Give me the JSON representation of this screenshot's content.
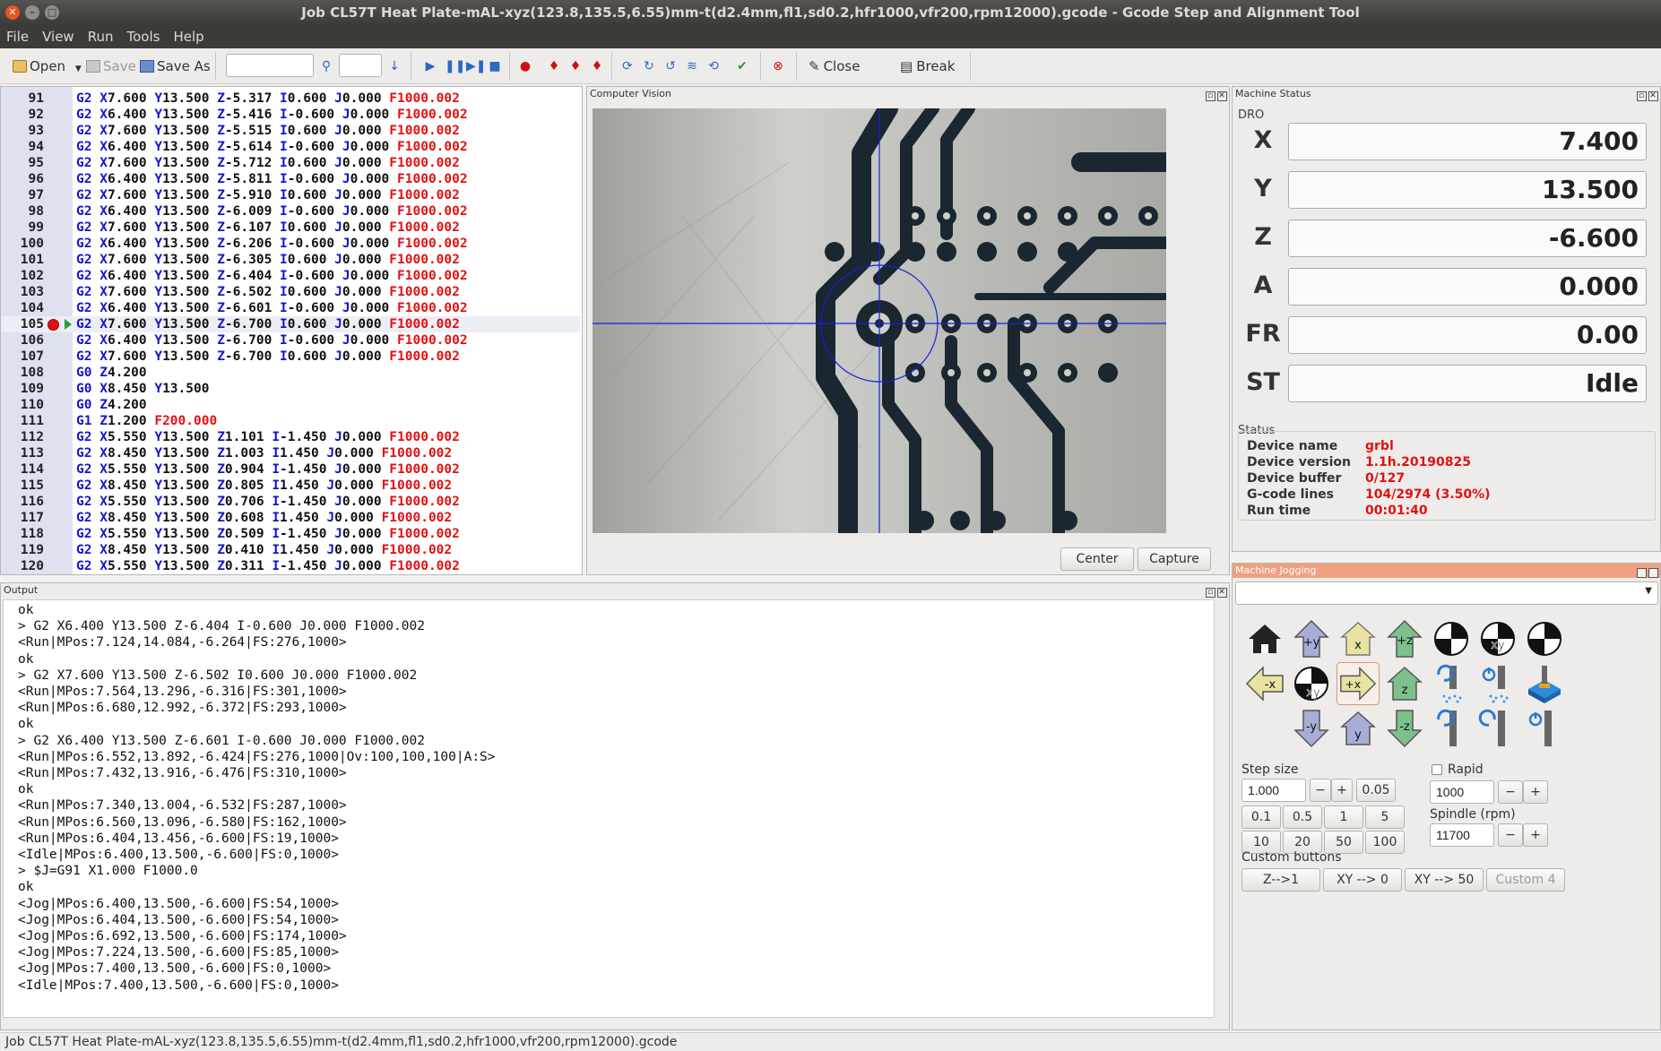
{
  "window": {
    "title": "Job CL57T Heat Plate-mAL-xyz(123.8,135.5,6.55)mm-t(d2.4mm,fl1,sd0.2,hfr1000,vfr200,rpm12000).gcode - Gcode Step and Alignment Tool"
  },
  "menu": [
    "File",
    "View",
    "Run",
    "Tools",
    "Help"
  ],
  "toolbar": {
    "open": "Open",
    "save": "Save",
    "save_as": "Save As",
    "close": "Close",
    "break": "Break",
    "search_value": "",
    "line_value": ""
  },
  "editor": {
    "lines": [
      {
        "n": "91",
        "t": "G2 X7.600 Y13.500 Z-5.317 I0.600 J0.000 F1000.002"
      },
      {
        "n": "92",
        "t": "G2 X6.400 Y13.500 Z-5.416 I-0.600 J0.000 F1000.002"
      },
      {
        "n": "93",
        "t": "G2 X7.600 Y13.500 Z-5.515 I0.600 J0.000 F1000.002"
      },
      {
        "n": "94",
        "t": "G2 X6.400 Y13.500 Z-5.614 I-0.600 J0.000 F1000.002"
      },
      {
        "n": "95",
        "t": "G2 X7.600 Y13.500 Z-5.712 I0.600 J0.000 F1000.002"
      },
      {
        "n": "96",
        "t": "G2 X6.400 Y13.500 Z-5.811 I-0.600 J0.000 F1000.002"
      },
      {
        "n": "97",
        "t": "G2 X7.600 Y13.500 Z-5.910 I0.600 J0.000 F1000.002"
      },
      {
        "n": "98",
        "t": "G2 X6.400 Y13.500 Z-6.009 I-0.600 J0.000 F1000.002"
      },
      {
        "n": "99",
        "t": "G2 X7.600 Y13.500 Z-6.107 I0.600 J0.000 F1000.002"
      },
      {
        "n": "100",
        "t": "G2 X6.400 Y13.500 Z-6.206 I-0.600 J0.000 F1000.002"
      },
      {
        "n": "101",
        "t": "G2 X7.600 Y13.500 Z-6.305 I0.600 J0.000 F1000.002"
      },
      {
        "n": "102",
        "t": "G2 X6.400 Y13.500 Z-6.404 I-0.600 J0.000 F1000.002"
      },
      {
        "n": "103",
        "t": "G2 X7.600 Y13.500 Z-6.502 I0.600 J0.000 F1000.002"
      },
      {
        "n": "104",
        "t": "G2 X6.400 Y13.500 Z-6.601 I-0.600 J0.000 F1000.002"
      },
      {
        "n": "105",
        "t": "G2 X7.600 Y13.500 Z-6.700 I0.600 J0.000 F1000.002"
      },
      {
        "n": "106",
        "t": "G2 X6.400 Y13.500 Z-6.700 I-0.600 J0.000 F1000.002"
      },
      {
        "n": "107",
        "t": "G2 X7.600 Y13.500 Z-6.700 I0.600 J0.000 F1000.002"
      },
      {
        "n": "108",
        "t": "G0 Z4.200"
      },
      {
        "n": "109",
        "t": "G0 X8.450 Y13.500"
      },
      {
        "n": "110",
        "t": "G0 Z4.200"
      },
      {
        "n": "111",
        "t": "G1 Z1.200 F200.000"
      },
      {
        "n": "112",
        "t": "G2 X5.550 Y13.500 Z1.101 I-1.450 J0.000 F1000.002"
      },
      {
        "n": "113",
        "t": "G2 X8.450 Y13.500 Z1.003 I1.450 J0.000 F1000.002"
      },
      {
        "n": "114",
        "t": "G2 X5.550 Y13.500 Z0.904 I-1.450 J0.000 F1000.002"
      },
      {
        "n": "115",
        "t": "G2 X8.450 Y13.500 Z0.805 I1.450 J0.000 F1000.002"
      },
      {
        "n": "116",
        "t": "G2 X5.550 Y13.500 Z0.706 I-1.450 J0.000 F1000.002"
      },
      {
        "n": "117",
        "t": "G2 X8.450 Y13.500 Z0.608 I1.450 J0.000 F1000.002"
      },
      {
        "n": "118",
        "t": "G2 X5.550 Y13.500 Z0.509 I-1.450 J0.000 F1000.002"
      },
      {
        "n": "119",
        "t": "G2 X8.450 Y13.500 Z0.410 I1.450 J0.000 F1000.002"
      },
      {
        "n": "120",
        "t": "G2 X5.550 Y13.500 Z0.311 I-1.450 J0.000 F1000.002"
      }
    ],
    "current_line": "105"
  },
  "computer_vision": {
    "title": "Computer Vision",
    "center": "Center",
    "capture": "Capture"
  },
  "machine_status": {
    "title": "Machine Status",
    "dro_title": "DRO",
    "dro": [
      {
        "label": "X",
        "value": "7.400"
      },
      {
        "label": "Y",
        "value": "13.500"
      },
      {
        "label": "Z",
        "value": "-6.600"
      },
      {
        "label": "A",
        "value": "0.000"
      },
      {
        "label": "FR",
        "value": "0.00"
      },
      {
        "label": "ST",
        "value": "Idle"
      }
    ],
    "status_title": "Status",
    "status": [
      {
        "k": "Device name",
        "v": "grbl"
      },
      {
        "k": "Device version",
        "v": "1.1h.20190825"
      },
      {
        "k": "Device buffer",
        "v": "0/127"
      },
      {
        "k": "G-code lines",
        "v": "104/2974 (3.50%)"
      },
      {
        "k": "Run time",
        "v": "00:01:40"
      }
    ]
  },
  "output": {
    "title": "Output",
    "lines": [
      "ok",
      "> G2 X6.400 Y13.500 Z-6.404 I-0.600 J0.000 F1000.002",
      "<Run|MPos:7.124,14.084,-6.264|FS:276,1000>",
      "ok",
      "> G2 X7.600 Y13.500 Z-6.502 I0.600 J0.000 F1000.002",
      "<Run|MPos:7.564,13.296,-6.316|FS:301,1000>",
      "<Run|MPos:6.680,12.992,-6.372|FS:293,1000>",
      "ok",
      "> G2 X6.400 Y13.500 Z-6.601 I-0.600 J0.000 F1000.002",
      "<Run|MPos:6.552,13.892,-6.424|FS:276,1000|Ov:100,100,100|A:S>",
      "<Run|MPos:7.432,13.916,-6.476|FS:310,1000>",
      "ok",
      "<Run|MPos:7.340,13.004,-6.532|FS:287,1000>",
      "<Run|MPos:6.560,13.096,-6.580|FS:162,1000>",
      "<Run|MPos:6.404,13.456,-6.600|FS:19,1000>",
      "<Idle|MPos:6.400,13.500,-6.600|FS:0,1000>",
      "> $J=G91 X1.000 F1000.0",
      "ok",
      "<Jog|MPos:6.400,13.500,-6.600|FS:54,1000>",
      "<Jog|MPos:6.404,13.500,-6.600|FS:54,1000>",
      "<Jog|MPos:6.692,13.500,-6.600|FS:174,1000>",
      "<Jog|MPos:7.224,13.500,-6.600|FS:85,1000>",
      "<Jog|MPos:7.400,13.500,-6.600|FS:0,1000>",
      "<Idle|MPos:7.400,13.500,-6.600|FS:0,1000>"
    ]
  },
  "jogging": {
    "title": "Machine Jogging",
    "step_size_label": "Step size",
    "step_value": "1.000",
    "rapid_label": "Rapid",
    "feed_value": "1000",
    "spindle_label": "Spindle (rpm)",
    "spindle_value": "11700",
    "step_presets": [
      "0.05",
      "0.1",
      "0.5",
      "1",
      "5",
      "10",
      "20",
      "50",
      "100"
    ],
    "minus": "−",
    "plus": "+",
    "custom_label": "Custom buttons",
    "custom": [
      "Z-->1",
      "XY --> 0",
      "XY --> 50",
      "Custom 4"
    ],
    "jog_labels": {
      "py": "+y",
      "x": "x",
      "pz": "+z",
      "mx": "-x",
      "xy": "xy",
      "px": "+x",
      "z": "z",
      "my": "-y",
      "y": "y",
      "mz": "-z",
      "xyz": "xy",
      "zz": "z"
    }
  },
  "statusbar": {
    "text": "Job CL57T Heat Plate-mAL-xyz(123.8,135.5,6.55)mm-t(d2.4mm,fl1,sd0.2,hfr1000,vfr200,rpm12000).gcode"
  },
  "colors": {
    "accent": "#e21010",
    "keyword": "#1414d0"
  }
}
